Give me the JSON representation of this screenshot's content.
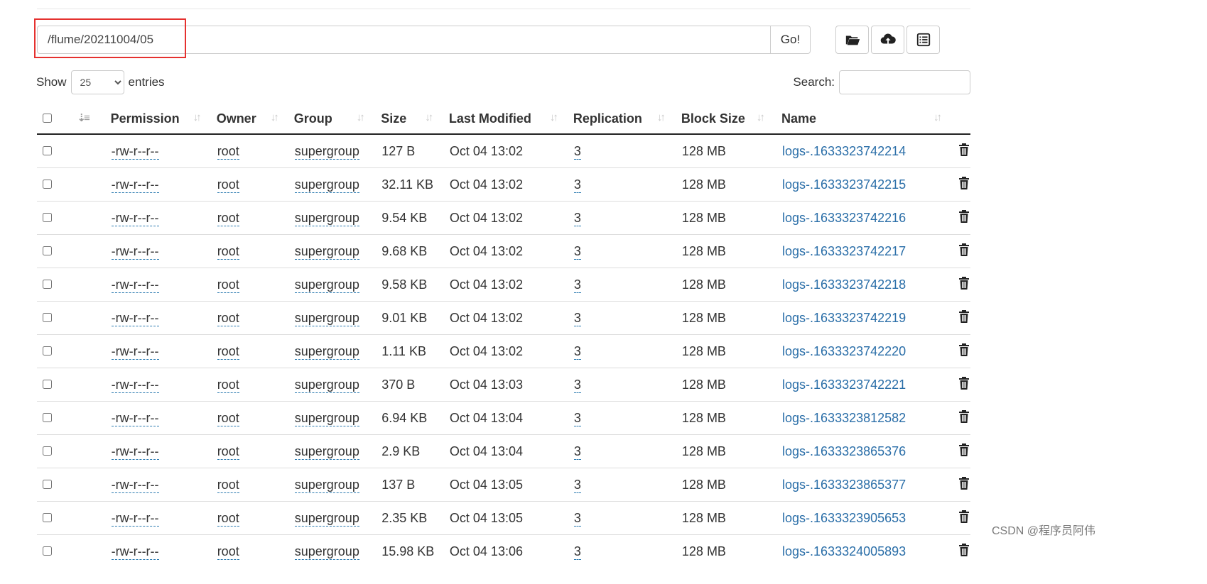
{
  "path_bar": {
    "value": "/flume/20211004/05",
    "go_label": "Go!"
  },
  "toolbar": {
    "buttons": [
      {
        "icon": "folder-open-icon"
      },
      {
        "icon": "cloud-upload-icon"
      },
      {
        "icon": "list-icon"
      }
    ]
  },
  "show_entries": {
    "show_label": "Show",
    "selected": "25",
    "entries_label": "entries"
  },
  "search": {
    "label": "Search:",
    "value": ""
  },
  "table": {
    "headers": {
      "permission": "Permission",
      "owner": "Owner",
      "group": "Group",
      "size": "Size",
      "last_modified": "Last Modified",
      "replication": "Replication",
      "block_size": "Block Size",
      "name": "Name"
    },
    "rows": [
      {
        "permission": "-rw-r--r--",
        "owner": "root",
        "group": "supergroup",
        "size": "127 B",
        "modified": "Oct 04 13:02",
        "replication": "3",
        "block_size": "128 MB",
        "name": "logs-.1633323742214"
      },
      {
        "permission": "-rw-r--r--",
        "owner": "root",
        "group": "supergroup",
        "size": "32.11 KB",
        "modified": "Oct 04 13:02",
        "replication": "3",
        "block_size": "128 MB",
        "name": "logs-.1633323742215"
      },
      {
        "permission": "-rw-r--r--",
        "owner": "root",
        "group": "supergroup",
        "size": "9.54 KB",
        "modified": "Oct 04 13:02",
        "replication": "3",
        "block_size": "128 MB",
        "name": "logs-.1633323742216"
      },
      {
        "permission": "-rw-r--r--",
        "owner": "root",
        "group": "supergroup",
        "size": "9.68 KB",
        "modified": "Oct 04 13:02",
        "replication": "3",
        "block_size": "128 MB",
        "name": "logs-.1633323742217"
      },
      {
        "permission": "-rw-r--r--",
        "owner": "root",
        "group": "supergroup",
        "size": "9.58 KB",
        "modified": "Oct 04 13:02",
        "replication": "3",
        "block_size": "128 MB",
        "name": "logs-.1633323742218"
      },
      {
        "permission": "-rw-r--r--",
        "owner": "root",
        "group": "supergroup",
        "size": "9.01 KB",
        "modified": "Oct 04 13:02",
        "replication": "3",
        "block_size": "128 MB",
        "name": "logs-.1633323742219"
      },
      {
        "permission": "-rw-r--r--",
        "owner": "root",
        "group": "supergroup",
        "size": "1.11 KB",
        "modified": "Oct 04 13:02",
        "replication": "3",
        "block_size": "128 MB",
        "name": "logs-.1633323742220"
      },
      {
        "permission": "-rw-r--r--",
        "owner": "root",
        "group": "supergroup",
        "size": "370 B",
        "modified": "Oct 04 13:03",
        "replication": "3",
        "block_size": "128 MB",
        "name": "logs-.1633323742221"
      },
      {
        "permission": "-rw-r--r--",
        "owner": "root",
        "group": "supergroup",
        "size": "6.94 KB",
        "modified": "Oct 04 13:04",
        "replication": "3",
        "block_size": "128 MB",
        "name": "logs-.1633323812582"
      },
      {
        "permission": "-rw-r--r--",
        "owner": "root",
        "group": "supergroup",
        "size": "2.9 KB",
        "modified": "Oct 04 13:04",
        "replication": "3",
        "block_size": "128 MB",
        "name": "logs-.1633323865376"
      },
      {
        "permission": "-rw-r--r--",
        "owner": "root",
        "group": "supergroup",
        "size": "137 B",
        "modified": "Oct 04 13:05",
        "replication": "3",
        "block_size": "128 MB",
        "name": "logs-.1633323865377"
      },
      {
        "permission": "-rw-r--r--",
        "owner": "root",
        "group": "supergroup",
        "size": "2.35 KB",
        "modified": "Oct 04 13:05",
        "replication": "3",
        "block_size": "128 MB",
        "name": "logs-.1633323905653"
      },
      {
        "permission": "-rw-r--r--",
        "owner": "root",
        "group": "supergroup",
        "size": "15.98 KB",
        "modified": "Oct 04 13:06",
        "replication": "3",
        "block_size": "128 MB",
        "name": "logs-.1633324005893"
      }
    ]
  },
  "watermark": "CSDN @程序员阿伟",
  "colors": {
    "highlight": "#e5312f",
    "link": "#2a6ea8"
  }
}
